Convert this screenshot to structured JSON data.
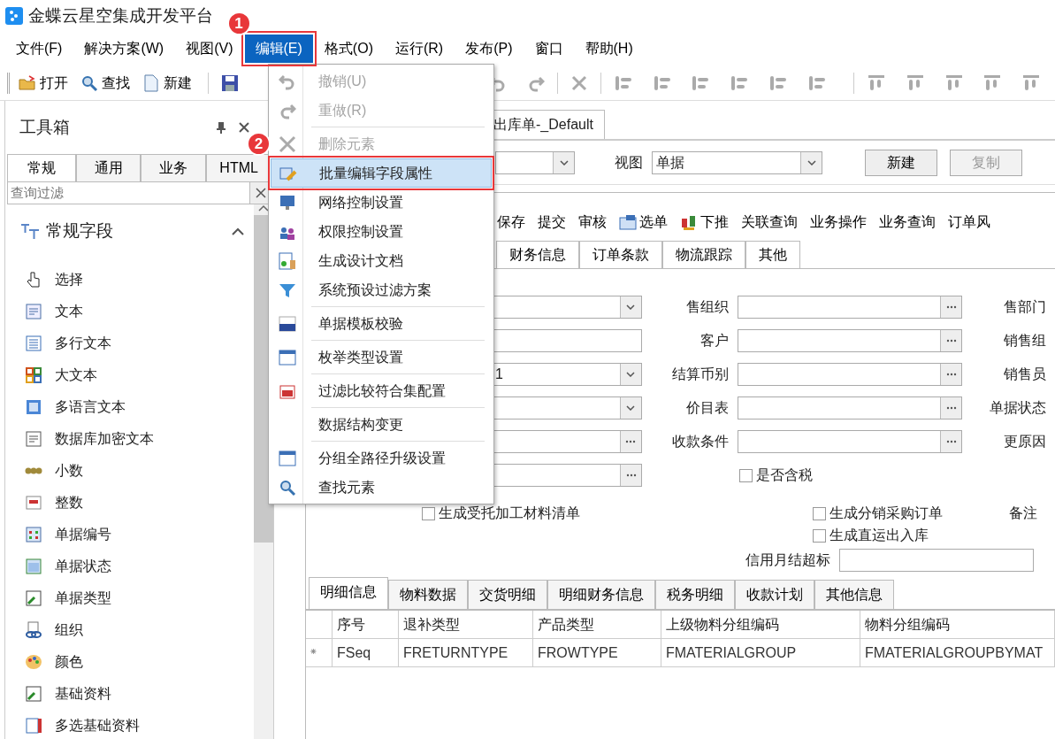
{
  "window": {
    "title": "金蝶云星空集成开发平台"
  },
  "menu_bar": [
    {
      "label": "文件(F)",
      "selected": false
    },
    {
      "label": "解决方案(W)",
      "selected": false
    },
    {
      "label": "视图(V)",
      "selected": false
    },
    {
      "label": "编辑(E)",
      "selected": true
    },
    {
      "label": "格式(O)",
      "selected": false
    },
    {
      "label": "运行(R)",
      "selected": false
    },
    {
      "label": "发布(P)",
      "selected": false
    },
    {
      "label": "窗口",
      "selected": false
    },
    {
      "label": "帮助(H)",
      "selected": false
    }
  ],
  "toolbar": [
    {
      "label": "打开"
    },
    {
      "label": "查找"
    },
    {
      "label": "新建"
    }
  ],
  "edit_menu": [
    {
      "kind": "item",
      "label": "撤销(U)",
      "disabled": true,
      "selected": false
    },
    {
      "kind": "item",
      "label": "重做(R)",
      "disabled": true,
      "selected": false
    },
    {
      "kind": "separator"
    },
    {
      "kind": "item",
      "label": "删除元素",
      "disabled": true,
      "selected": false
    },
    {
      "kind": "item",
      "label": "批量编辑字段属性",
      "disabled": false,
      "selected": true
    },
    {
      "kind": "item",
      "label": "网络控制设置",
      "disabled": false,
      "selected": false
    },
    {
      "kind": "item",
      "label": "权限控制设置",
      "disabled": false,
      "selected": false
    },
    {
      "kind": "item",
      "label": "生成设计文档",
      "disabled": false,
      "selected": false
    },
    {
      "kind": "item",
      "label": "系统预设过滤方案",
      "disabled": false,
      "selected": false
    },
    {
      "kind": "separator"
    },
    {
      "kind": "item",
      "label": "单据模板校验",
      "disabled": false,
      "selected": false
    },
    {
      "kind": "separator"
    },
    {
      "kind": "item",
      "label": "枚举类型设置",
      "disabled": false,
      "selected": false
    },
    {
      "kind": "separator"
    },
    {
      "kind": "item",
      "label": "过滤比较符合集配置",
      "disabled": false,
      "selected": false
    },
    {
      "kind": "separator"
    },
    {
      "kind": "item",
      "label": "数据结构变更",
      "disabled": false,
      "selected": false
    },
    {
      "kind": "separator"
    },
    {
      "kind": "item",
      "label": "分组全路径升级设置",
      "disabled": false,
      "selected": false
    },
    {
      "kind": "item",
      "label": "查找元素",
      "disabled": false,
      "selected": false
    }
  ],
  "callouts": [
    "1",
    "2"
  ],
  "toolbox": {
    "title": "工具箱",
    "tabs": [
      {
        "label": "常规",
        "selected": true
      },
      {
        "label": "通用",
        "selected": false
      },
      {
        "label": "业务",
        "selected": false
      },
      {
        "label": "HTML",
        "selected": false
      }
    ],
    "filter": {
      "placeholder": "查询过滤"
    },
    "group": {
      "label": "常规字段",
      "expanded": true
    },
    "items": [
      "选择",
      "文本",
      "多行文本",
      "大文本",
      "多语言文本",
      "数据库加密文本",
      "小数",
      "整数",
      "单据编号",
      "单据状态",
      "单据类型",
      "组织",
      "颜色",
      "基础资料",
      "多选基础资料"
    ]
  },
  "document_tab": "出库单-_Default",
  "view_bar": {
    "view_label": "视图",
    "view_value": "单据",
    "buttons": [
      {
        "label": "新建",
        "disabled": false
      },
      {
        "label": "复制",
        "disabled": true
      }
    ]
  },
  "designer": {
    "actions": [
      {
        "label": "保存"
      },
      {
        "label": "提交"
      },
      {
        "label": "审核"
      },
      {
        "label": "选单"
      },
      {
        "label": "下推"
      },
      {
        "label": "关联查询"
      },
      {
        "label": "业务操作"
      },
      {
        "label": "业务查询"
      },
      {
        "label": "订单风"
      }
    ],
    "tabs": [
      {
        "label": "财务信息",
        "selected": false
      },
      {
        "label": "订单条款",
        "selected": false
      },
      {
        "label": "物流跟踪",
        "selected": false
      },
      {
        "label": "其他",
        "selected": false
      }
    ],
    "rows": [
      {
        "left_field": {
          "kind": "combo"
        },
        "label": "售组织",
        "middle_field": {
          "kind": "lookup"
        },
        "right_label": "售部门"
      },
      {
        "left_field": {
          "kind": "text"
        },
        "label": "客户",
        "middle_field": {
          "kind": "lookup"
        },
        "right_label": "销售组"
      },
      {
        "left_field": {
          "kind": "combo",
          "value": "1"
        },
        "label": "结算币别",
        "middle_field": {
          "kind": "lookup"
        },
        "right_label": "销售员"
      },
      {
        "left_field": {
          "kind": "combo"
        },
        "label": "价目表",
        "middle_field": {
          "kind": "lookup"
        },
        "right_label": "单据状态"
      },
      {
        "left_field": {
          "kind": "lookup"
        },
        "label": "收款条件",
        "middle_field": {
          "kind": "lookup"
        },
        "right_label": "更原因"
      },
      {
        "left_field": {
          "kind": "lookup"
        },
        "checkbox": {
          "label": "是否含税",
          "checked": false
        }
      }
    ],
    "checkboxes": [
      {
        "label": "生成受托加工材料清单",
        "checked": false
      },
      {
        "label": "生成分销采购订单",
        "checked": false
      },
      {
        "label": "生成直运出入库",
        "checked": false
      }
    ],
    "remark_label": "备注",
    "credit_label": "信用月结超标",
    "detail_tabs": [
      {
        "label": "明细信息",
        "selected": true
      },
      {
        "label": "物料数据",
        "selected": false
      },
      {
        "label": "交货明细",
        "selected": false
      },
      {
        "label": "明细财务信息",
        "selected": false
      },
      {
        "label": "税务明细",
        "selected": false
      },
      {
        "label": "收款计划",
        "selected": false
      },
      {
        "label": "其他信息",
        "selected": false
      }
    ],
    "table": {
      "columns": [
        "序号",
        "退补类型",
        "产品类型",
        "上级物料分组编码",
        "物料分组编码"
      ],
      "rows": [
        {
          "marker": "⁕",
          "cells": [
            "FSeq",
            "FRETURNTYPE",
            "FROWTYPE",
            "FMATERIALGROUP",
            "FMATERIALGROUPBYMAT"
          ]
        }
      ]
    }
  }
}
